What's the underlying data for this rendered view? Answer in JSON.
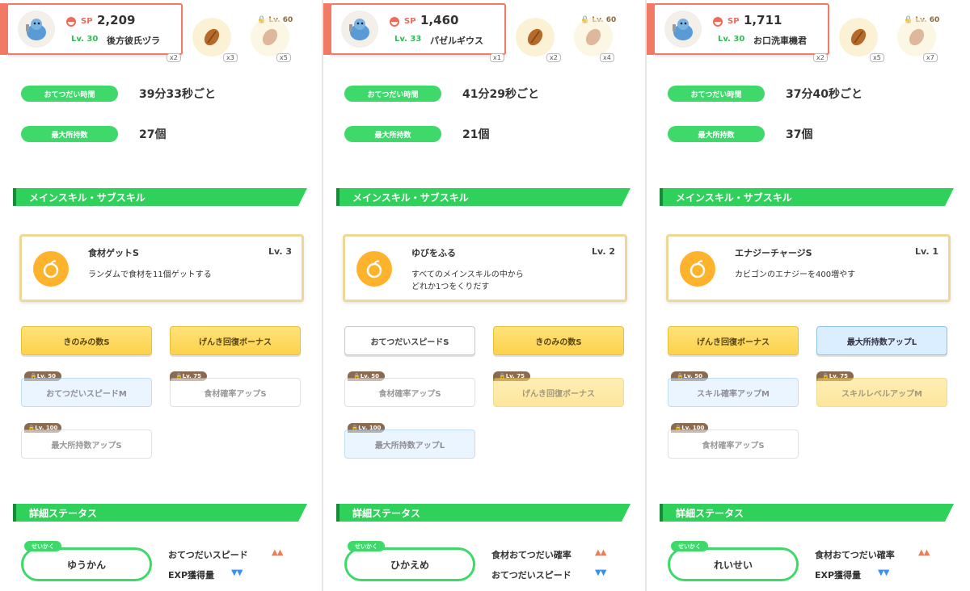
{
  "accent_green": "#3ED96A",
  "accent_coral": "#F07A66",
  "section_title_skills": "メインスキル・サブスキル",
  "section_title_status": "詳細ステータス",
  "label_help_time": "おてつだい時間",
  "label_max_carry": "最大所持数",
  "sp_label": "SP",
  "nature_tag": "せいかく",
  "panels": [
    {
      "sp": "2,209",
      "level": "Lv. 30",
      "name": "後方彼氏ヅラ",
      "pokemon_icon": "blastoise-icon",
      "ingredients": [
        {
          "icon": "cacao-icon",
          "count": "x3"
        },
        {
          "icon": "cacao-faded-icon",
          "count": "x5",
          "lock": "Lv. 60"
        }
      ],
      "hidden_count": "x2",
      "help_time": "39分33秒ごと",
      "max_carry": "27個",
      "main_skill": {
        "name": "食材ゲットS",
        "level": "Lv. 3",
        "desc": "ランダムで食材を11個ゲットする",
        "icon": "apple-icon"
      },
      "subskills": [
        {
          "label": "きのみの数S",
          "style": "gold",
          "lock": ""
        },
        {
          "label": "げんき回復ボーナス",
          "style": "gold",
          "lock": ""
        },
        {
          "label": "おてつだいスピードM",
          "style": "blue",
          "lock": "Lv. 50"
        },
        {
          "label": "食材確率アップS",
          "style": "white",
          "lock": "Lv. 75"
        },
        {
          "label": "最大所持数アップS",
          "style": "white",
          "lock": "Lv. 100"
        }
      ],
      "nature": "ゆうかん",
      "nature_up": "おてつだいスピード",
      "nature_down": "EXP獲得量"
    },
    {
      "sp": "1,460",
      "level": "Lv. 33",
      "name": "パゼルギウス",
      "pokemon_icon": "togekiss-icon",
      "ingredients": [
        {
          "icon": "egg-icon",
          "count": "x2"
        },
        {
          "icon": "egg-icon",
          "count": "x4",
          "lock": "Lv. 60"
        }
      ],
      "hidden_count": "x1",
      "help_time": "41分29秒ごと",
      "max_carry": "21個",
      "main_skill": {
        "name": "ゆびをふる",
        "level": "Lv. 2",
        "desc": "すべてのメインスキルの中から\nどれか1つをくりだす",
        "icon": "finger-icon"
      },
      "subskills": [
        {
          "label": "おてつだいスピードS",
          "style": "white",
          "lock": ""
        },
        {
          "label": "きのみの数S",
          "style": "gold",
          "lock": ""
        },
        {
          "label": "食材確率アップS",
          "style": "white",
          "lock": "Lv. 50"
        },
        {
          "label": "げんき回復ボーナス",
          "style": "gold",
          "lock": "Lv. 75"
        },
        {
          "label": "最大所持数アップL",
          "style": "blue",
          "lock": "Lv. 100"
        }
      ],
      "nature": "ひかえめ",
      "nature_up": "食材おてつだい確率",
      "nature_down": "おてつだいスピード"
    },
    {
      "sp": "1,711",
      "level": "Lv. 30",
      "name": "お口洗車機君",
      "pokemon_icon": "crabominable-icon",
      "ingredients": [
        {
          "icon": "apple-icon",
          "count": "x5"
        },
        {
          "icon": "honey-icon",
          "count": "x7",
          "lock": "Lv. 60"
        }
      ],
      "hidden_count": "x2",
      "help_time": "37分40秒ごと",
      "max_carry": "37個",
      "main_skill": {
        "name": "エナジーチャージS",
        "level": "Lv. 1",
        "desc": "カビゴンのエナジーを400増やす",
        "icon": "flame-icon"
      },
      "subskills": [
        {
          "label": "げんき回復ボーナス",
          "style": "gold",
          "lock": ""
        },
        {
          "label": "最大所持数アップL",
          "style": "blue",
          "lock": ""
        },
        {
          "label": "スキル確率アップM",
          "style": "blue",
          "lock": "Lv. 50"
        },
        {
          "label": "スキルレベルアップM",
          "style": "gold",
          "lock": "Lv. 75"
        },
        {
          "label": "食材確率アップS",
          "style": "white",
          "lock": "Lv. 100"
        }
      ],
      "nature": "れいせい",
      "nature_up": "食材おてつだい確率",
      "nature_down": "EXP獲得量"
    }
  ]
}
